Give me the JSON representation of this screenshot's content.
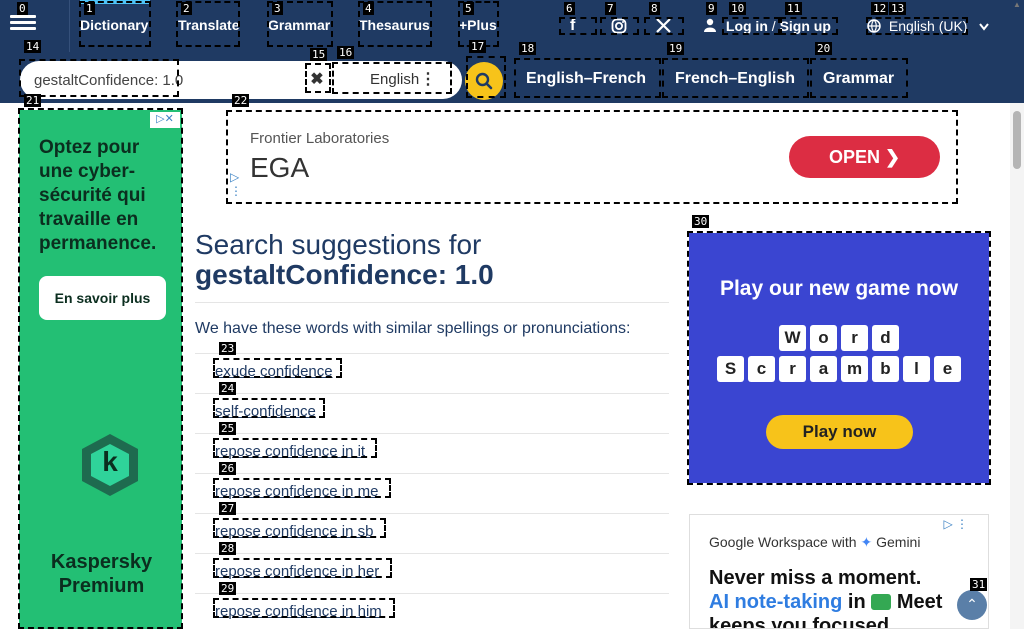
{
  "nav": {
    "items": [
      {
        "label": "Dictionary"
      },
      {
        "label": "Translate"
      },
      {
        "label": "Grammar"
      },
      {
        "label": "Thesaurus"
      },
      {
        "label": "+Plus"
      }
    ],
    "auth": {
      "login": "Log in",
      "sep": "/",
      "signup": "Sign up"
    },
    "language": "English (UK)",
    "social": [
      "facebook-icon",
      "instagram-icon",
      "x-icon"
    ]
  },
  "search": {
    "value": "gestaltConfidence: 1.0",
    "dictionary": "English",
    "quick_links": [
      "English–French",
      "French–English",
      "Grammar"
    ]
  },
  "ads": {
    "left": {
      "headline": "Optez pour une cyber-sécurité qui travaille en permanence.",
      "cta": "En savoir plus",
      "logo_letter": "k",
      "brand": "Kaspersky Premium"
    },
    "top": {
      "company": "Frontier Laboratories",
      "product": "EGA",
      "cta": "OPEN"
    },
    "game": {
      "title": "Play our new game now",
      "word1": [
        "W",
        "o",
        "r",
        "d"
      ],
      "word2": [
        "S",
        "c",
        "r",
        "a",
        "m",
        "b",
        "l",
        "e"
      ],
      "cta": "Play now"
    },
    "workspace": {
      "small": "Google Workspace with",
      "gemini": "Gemini",
      "line1": "Never miss a moment.",
      "line2_blue": "AI note-taking",
      "line2_rest": "in",
      "meet": "Meet",
      "line3": "keeps you focused."
    }
  },
  "main": {
    "heading": "Search suggestions for",
    "query": "gestaltConfidence: 1.0",
    "intro": "We have these words with similar spellings or pronunciations:",
    "suggestions": [
      "exude confidence",
      "self-confidence",
      "repose confidence in it",
      "repose confidence in me",
      "repose confidence in sb",
      "repose confidence in her",
      "repose confidence in him"
    ]
  },
  "overlay": {
    "tags": [
      "0",
      "1",
      "2",
      "3",
      "4",
      "5",
      "6",
      "7",
      "8",
      "9",
      "10",
      "11",
      "12",
      "13",
      "14",
      "15",
      "16",
      "17",
      "18",
      "19",
      "20",
      "21",
      "22",
      "23",
      "24",
      "25",
      "26",
      "27",
      "28",
      "29",
      "30",
      "31"
    ]
  },
  "colors": {
    "brand": "#1f3a63",
    "accent": "#f7c31a",
    "ad_green": "#23bf74",
    "ad_red": "#dc2d43",
    "game_blue": "#3a45d1"
  }
}
